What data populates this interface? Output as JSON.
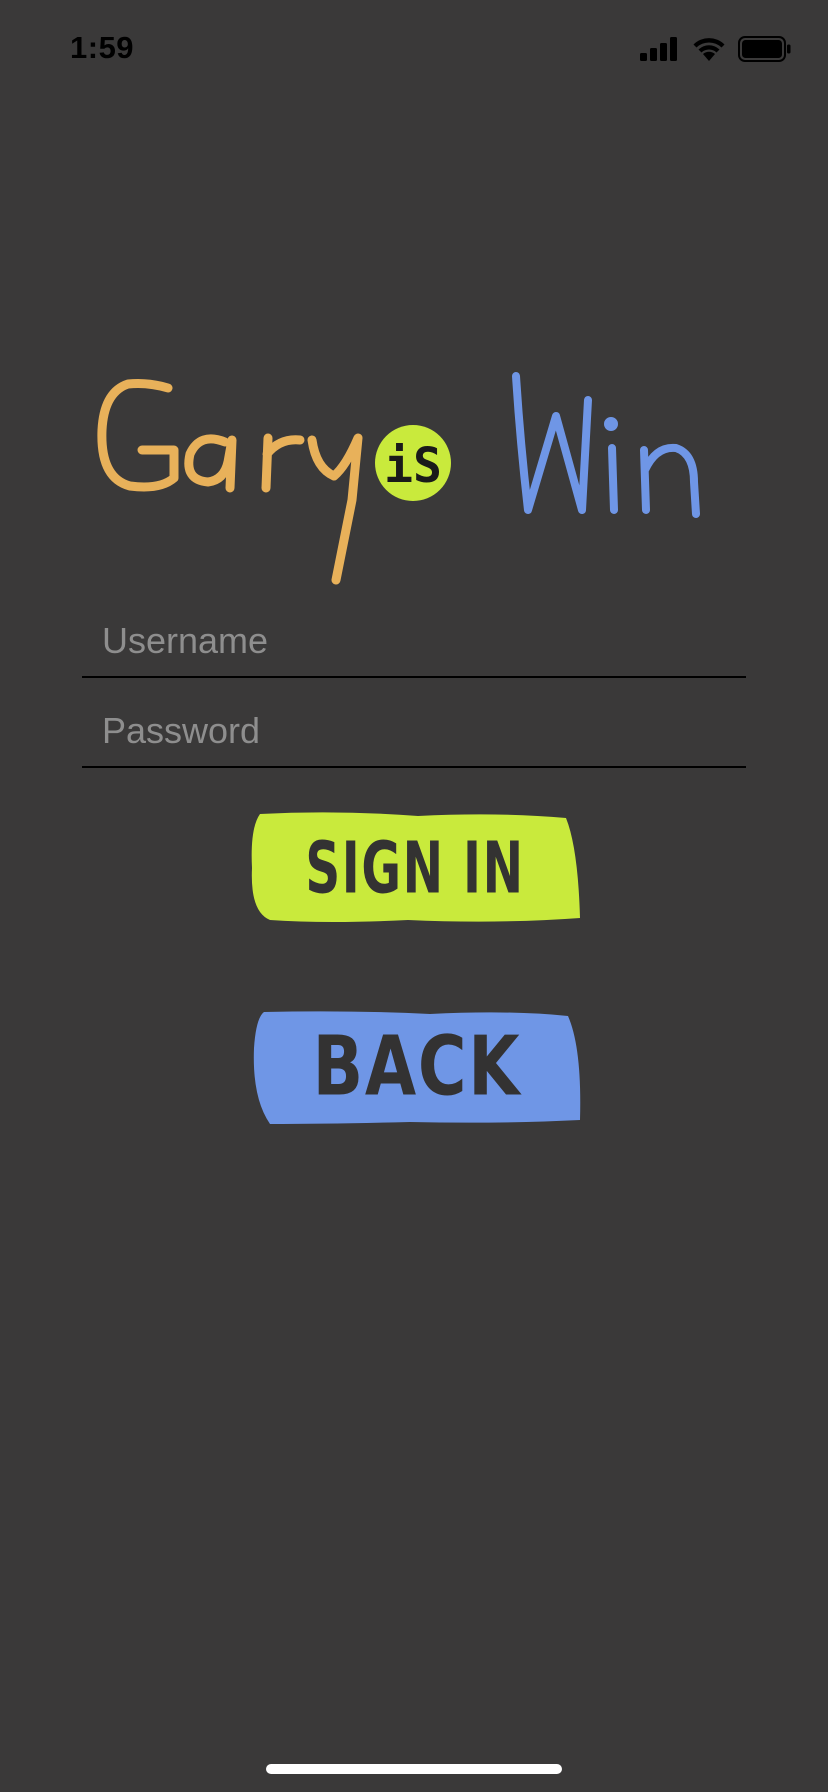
{
  "status_bar": {
    "time": "1:59",
    "icons": [
      "cellular-signal-icon",
      "wifi-icon",
      "battery-icon"
    ]
  },
  "logo": {
    "word_1": "Gary",
    "word_2": "iS",
    "word_3": "Win",
    "colors": {
      "gary": "#e8b15a",
      "is_badge": "#c9ea3c",
      "win": "#6f96e6"
    }
  },
  "form": {
    "username_placeholder": "Username",
    "username_value": "",
    "password_placeholder": "Password",
    "password_value": ""
  },
  "buttons": {
    "sign_in_label": "SIGN IN",
    "sign_in_color": "#c9ea3c",
    "back_label": "BACK",
    "back_color": "#6f96e6"
  },
  "theme": {
    "background": "#3a3939",
    "divider": "#000000",
    "placeholder": "#8e8e8e"
  }
}
